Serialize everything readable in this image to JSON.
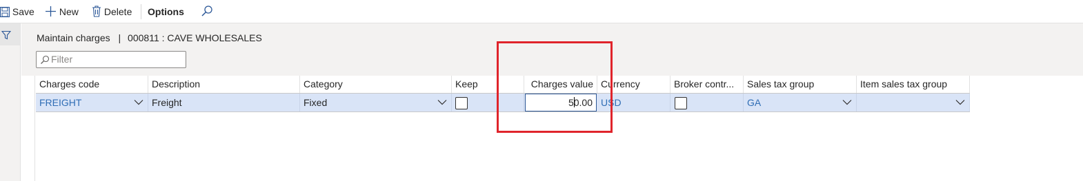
{
  "toolbar": {
    "save_label": "Save",
    "new_label": "New",
    "delete_label": "Delete",
    "options_label": "Options"
  },
  "header": {
    "page_title": "Maintain charges",
    "separator": "|",
    "record": "000811 : CAVE WHOLESALES"
  },
  "filter": {
    "placeholder": "Filter"
  },
  "grid": {
    "columns": [
      "Charges code",
      "Description",
      "Category",
      "Keep",
      "Charges value",
      "Currency",
      "Broker contr...",
      "Sales tax group",
      "Item sales tax group"
    ],
    "rows": [
      {
        "charges_code": "FREIGHT",
        "description": "Freight",
        "category": "Fixed",
        "keep": false,
        "charges_value_before_caret": "5",
        "charges_value_after_caret": "0.00",
        "currency": "USD",
        "broker_contribution": false,
        "sales_tax_group": "GA",
        "item_sales_tax_group": ""
      }
    ]
  },
  "colors": {
    "selected_row": "#d9e4f7",
    "link": "#2f6db5",
    "highlight": "#e0242b",
    "header_bg": "#f3f2f1"
  },
  "icons": [
    "save-icon",
    "new-icon",
    "delete-icon",
    "search-icon",
    "filter-funnel-icon",
    "filter-search-icon",
    "chevron-down-icon"
  ]
}
